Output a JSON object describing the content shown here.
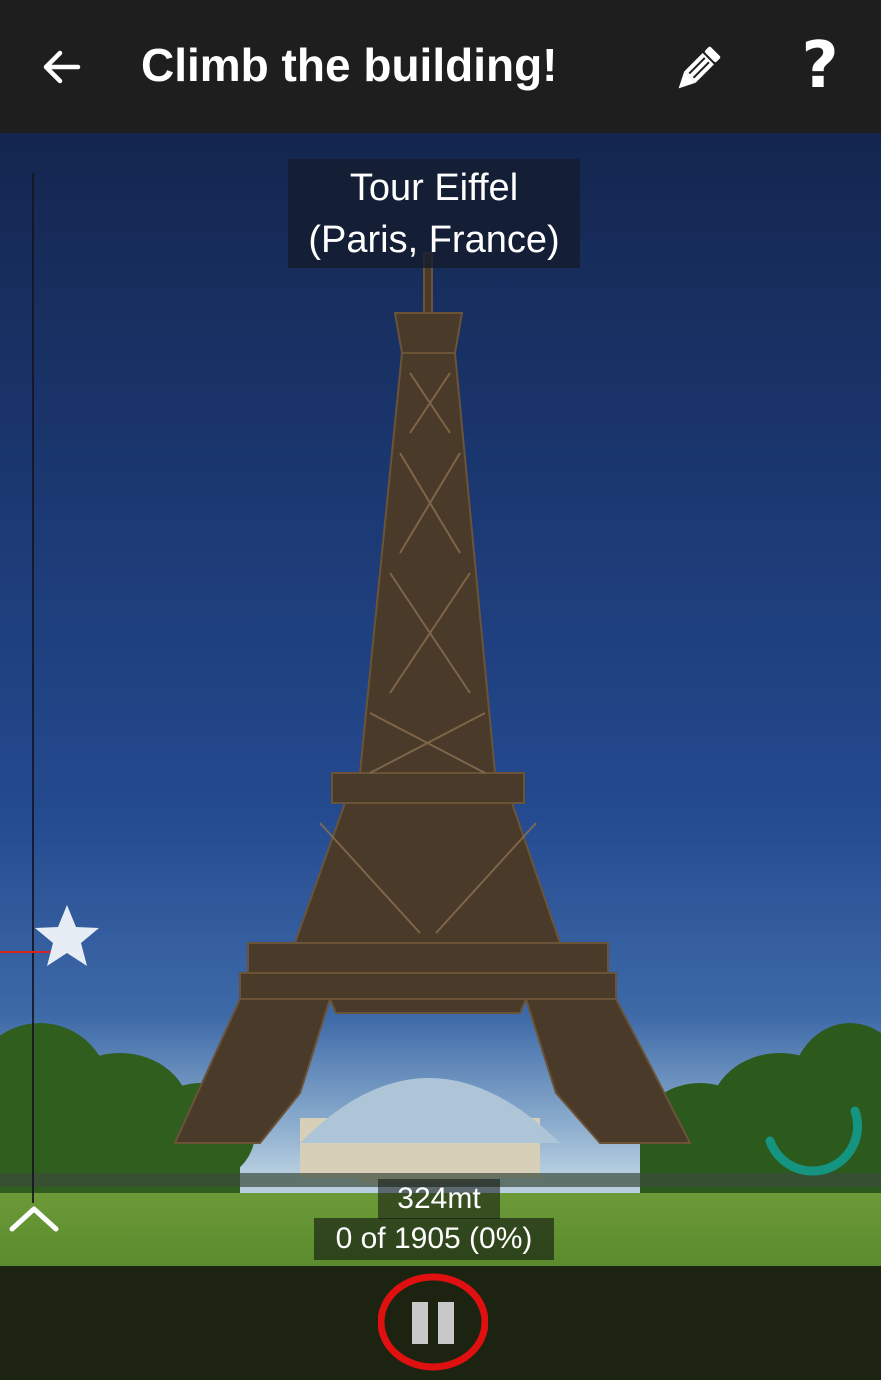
{
  "app_bar": {
    "title": "Climb the building!",
    "back_icon": "arrow-left-icon",
    "edit_icon": "pencil-icon",
    "help_label": "?"
  },
  "scene": {
    "building_label": "Tour Eiffel\n(Paris, France)",
    "height_label": "324mt",
    "progress_text": "0 of 1905 (0%)",
    "progress_fraction": 0,
    "marker_icon": "star-icon",
    "scroll_up_icon": "chevron-up-icon",
    "loading_icon": "spinner-icon"
  },
  "controls": {
    "pause_icon": "pause-icon"
  },
  "colors": {
    "app_bar": "#1e1e1e",
    "marker_line": "#d9231d",
    "spinner": "#149481",
    "pause_ring": "#e01010"
  }
}
